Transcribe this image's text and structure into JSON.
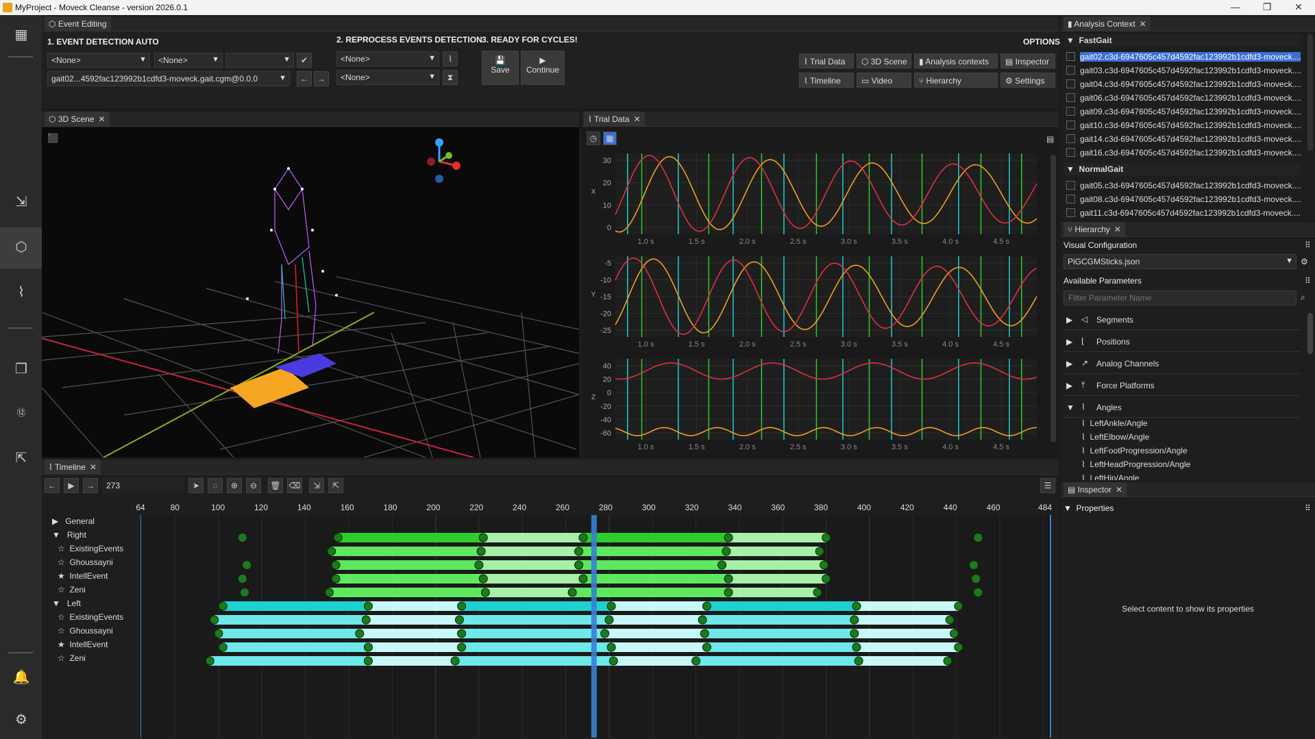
{
  "window": {
    "title": "MyProject - Moveck Cleanse - version 2026.0.1",
    "buttons": [
      "—",
      "❐",
      "✕"
    ]
  },
  "tabs": {
    "event_editing": "Event Editing",
    "scene": "3D Scene",
    "trial": "Trial Data",
    "timeline": "Timeline",
    "analysis": "Analysis Context",
    "hierarchy": "Hierarchy",
    "inspector": "Inspector"
  },
  "event_editing": {
    "step1": "1. EVENT DETECTION AUTO",
    "step2": "2. REPROCESS EVENTS DETECTION",
    "step3": "3. READY FOR CYCLES!",
    "options": "OPTIONS",
    "dd1": "<None>",
    "dd2": "<None>",
    "dd3": "",
    "file": "gait02...4592fac123992b1cdfd3-moveck.gait.cgm@0.0.0",
    "dd4": "<None>",
    "dd5": "<None>",
    "save": "Save",
    "continue": "Continue",
    "opt_buttons": [
      "Trial Data",
      "3D Scene",
      "Analysis contexts",
      "Inspector",
      "Timeline",
      "Video",
      "Hierarchy",
      "Settings"
    ]
  },
  "analysis": {
    "group1": "FastGait",
    "group1_items": [
      "gait02.c3d-6947605c457d4592fac123992b1cdfd3-moveck....",
      "gait03.c3d-6947605c457d4592fac123992b1cdfd3-moveck....",
      "gait04.c3d-6947605c457d4592fac123992b1cdfd3-moveck....",
      "gait06.c3d-6947605c457d4592fac123992b1cdfd3-moveck....",
      "gait09.c3d-6947605c457d4592fac123992b1cdfd3-moveck....",
      "gait10.c3d-6947605c457d4592fac123992b1cdfd3-moveck....",
      "gait14.c3d-6947605c457d4592fac123992b1cdfd3-moveck....",
      "gait16.c3d-6947605c457d4592fac123992b1cdfd3-moveck...."
    ],
    "group2": "NormalGait",
    "group2_items": [
      "gait05.c3d-6947605c457d4592fac123992b1cdfd3-moveck....",
      "gait08.c3d-6947605c457d4592fac123992b1cdfd3-moveck....",
      "gait11.c3d-6947605c457d4592fac123992b1cdfd3-moveck...."
    ]
  },
  "hierarchy": {
    "visual_config": "Visual Configuration",
    "config_file": "PiGCGMSticks.json",
    "available": "Available Parameters",
    "filter_placeholder": "Filter Parameter Name",
    "params": [
      "Segments",
      "Positions",
      "Analog Channels",
      "Force Platforms",
      "Angles"
    ],
    "angles": [
      "LeftAnkle/Angle",
      "LeftElbow/Angle",
      "LeftFootProgression/Angle",
      "LeftHeadProgression/Angle",
      "LeftHip/Angle"
    ]
  },
  "inspector": {
    "properties": "Properties",
    "empty": "Select content to show its properties"
  },
  "timeline": {
    "frame": "273",
    "ticks": [
      "64",
      "80",
      "100",
      "120",
      "140",
      "160",
      "180",
      "200",
      "220",
      "240",
      "260",
      "280",
      "300",
      "320",
      "340",
      "360",
      "380",
      "400",
      "420",
      "440",
      "460",
      "484"
    ],
    "rows": [
      "General",
      "Right",
      "ExistingEvents",
      "Ghoussayni",
      "IntellEvent",
      "Zeni",
      "Left",
      "ExistingEvents",
      "Ghoussayni",
      "IntellEvent",
      "Zeni"
    ]
  },
  "trial": {
    "axes": [
      "X",
      "Y",
      "Z"
    ],
    "x_ticks": [
      "1.0 s",
      "1.5 s",
      "2.0 s",
      "2.5 s",
      "3.0 s",
      "3.5 s",
      "4.0 s",
      "4.5 s"
    ],
    "y1": [
      "30",
      "20",
      "10",
      "0"
    ],
    "y2": [
      "-5",
      "-10",
      "-15",
      "-20",
      "-25"
    ],
    "y3": [
      "40",
      "20",
      "0",
      "-20",
      "-40",
      "-60"
    ]
  },
  "colors": {
    "green": "#2ecc2e",
    "cyan": "#1fd0d0",
    "orange": "#f0a020",
    "red": "#e03040",
    "accent": "#3b6fd4"
  }
}
